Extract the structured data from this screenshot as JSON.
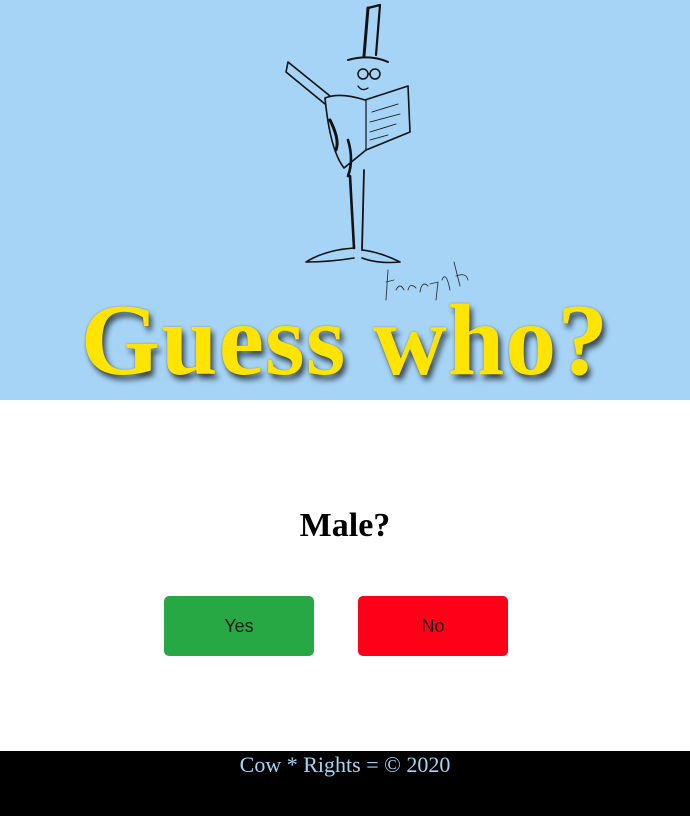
{
  "banner": {
    "title": "Guess who?",
    "background_color": "#a6d4f7",
    "title_color": "#ffe400",
    "illustration": "sketch-man-top-hat"
  },
  "quiz": {
    "question": "Male?",
    "yes_label": "Yes",
    "no_label": "No",
    "yes_color": "#28a745",
    "no_color": "#ff0019"
  },
  "footer": {
    "text": "Cow * Rights = © 2020",
    "text_color": "#a6d4f7",
    "background_color": "#000000"
  }
}
